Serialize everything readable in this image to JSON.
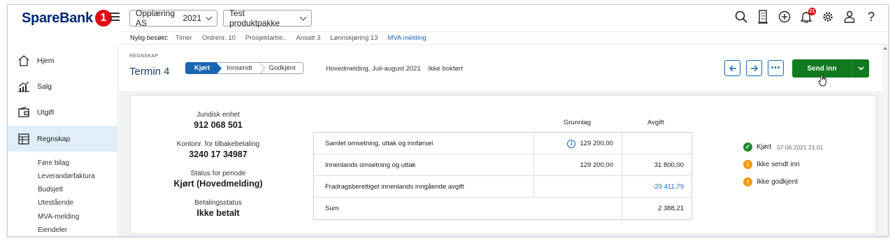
{
  "app": {
    "logo_text": "SpareBank",
    "logo_number": "1",
    "company_select": "Opplæring AS",
    "year_select": "2021",
    "package_select": "Test produktpakke",
    "notification_count": "21",
    "accent_color": "#1a66b3",
    "brand_color": "#002776"
  },
  "recent": {
    "label": "Nylig besøkt:",
    "items": [
      "Timer",
      "Ordrenr. 10",
      "Prosjektarbe..",
      "Ansatt 3",
      "Lønnskjøring 13",
      "MVA melding"
    ]
  },
  "sidebar": {
    "items": [
      {
        "label": "Hjem",
        "icon": "home-icon"
      },
      {
        "label": "Salg",
        "icon": "sales-chart-icon"
      },
      {
        "label": "Utgift",
        "icon": "wallet-icon"
      },
      {
        "label": "Regnskap",
        "icon": "ledger-icon"
      }
    ],
    "subitems": [
      "Føre bilag",
      "Leverandørfaktura",
      "Budsjett",
      "Utestående",
      "MVA-melding",
      "Eiendeler"
    ]
  },
  "header": {
    "section": "REGNSKAP",
    "title": "Termin 4",
    "steps": [
      "Kjørt",
      "Innsendt",
      "Godkjent"
    ],
    "meta_type": "Hovedmelding, Juli-august 2021",
    "meta_status": "Ikke bokført",
    "send_label": "Send inn"
  },
  "info": {
    "entity_label": "Juridisk enhet",
    "entity_value": "912 068 501",
    "account_label": "Kontonr. for tilbakebetaling",
    "account_value": "3240 17 34987",
    "period_label": "Status for periode",
    "period_value": "Kjørt (Hovedmelding)",
    "payment_label": "Betalingsstatus",
    "payment_value": "Ikke betalt"
  },
  "table": {
    "col_base": "Grunnlag",
    "col_fee": "Avgift",
    "rows": [
      {
        "label": "Samlet omsetning, uttak og innførsel",
        "base": "129 200,00",
        "fee": ""
      },
      {
        "label": "Innenlands omsetning og uttak",
        "base": "129 200,00",
        "fee": "31 800,00"
      },
      {
        "label": "Fradragsberettiget innenlands inngående avgift",
        "base": "",
        "fee": "-29 411,79"
      },
      {
        "label": "Sum",
        "base": "",
        "fee": "2 388,21"
      }
    ]
  },
  "statuses": [
    {
      "label": "Kjørt",
      "time": "07.06.2021 21:01",
      "state": "ok"
    },
    {
      "label": "Ikke sendt inn",
      "time": "",
      "state": "warn"
    },
    {
      "label": "Ikke godkjent",
      "time": "",
      "state": "warn"
    }
  ]
}
